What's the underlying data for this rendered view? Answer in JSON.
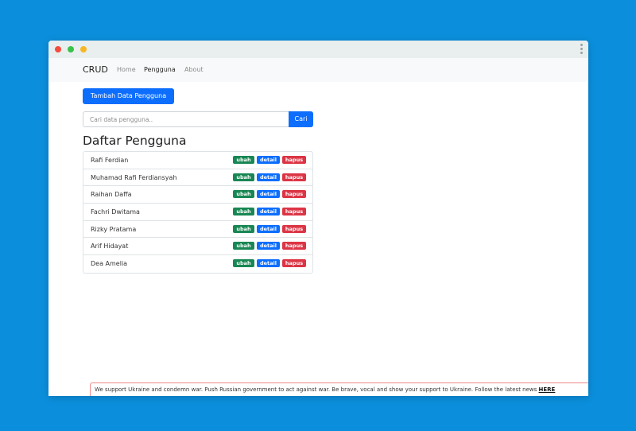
{
  "window": {
    "traffic_lights": [
      "close",
      "minimize",
      "maximize"
    ],
    "menu_icon": "vertical-ellipsis-icon"
  },
  "navbar": {
    "brand": "CRUD",
    "links": [
      {
        "label": "Home",
        "active": false
      },
      {
        "label": "Pengguna",
        "active": true
      },
      {
        "label": "About",
        "active": false
      }
    ]
  },
  "main": {
    "add_button": "Tambah Data Pengguna",
    "search": {
      "placeholder": "Cari data pengguna..",
      "value": "",
      "button": "Cari"
    },
    "title": "Daftar Pengguna",
    "users": [
      {
        "name": "Rafi Ferdian"
      },
      {
        "name": "Muhamad Rafi Ferdiansyah"
      },
      {
        "name": "Raihan Daffa"
      },
      {
        "name": "Fachri Dwitama"
      },
      {
        "name": "Rizky Pratama"
      },
      {
        "name": "Arif Hidayat"
      },
      {
        "name": "Dea Amelia"
      }
    ],
    "actions": {
      "edit": "ubah",
      "detail": "detail",
      "delete": "hapus"
    }
  },
  "banner": {
    "text": "We support Ukraine and condemn war. Push Russian government to act against war. Be brave, vocal and show your support to Ukraine. Follow the latest news ",
    "link": "HERE"
  },
  "colors": {
    "background": "#0b8fdc",
    "primary": "#0d6efd",
    "success": "#198754",
    "danger": "#dc3545"
  }
}
